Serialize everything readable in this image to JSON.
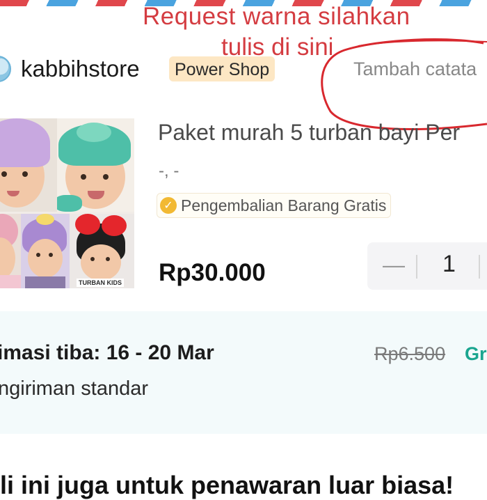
{
  "annotation": {
    "line1": "Request warna silahkan",
    "line2": "tulis di sini"
  },
  "store": {
    "name": "kabbihstore",
    "badge": "Power Shop",
    "note_link": "Tambah catata"
  },
  "product": {
    "title": "Paket murah 5 turban bayi Per",
    "variant": "-, -",
    "return_tag": "Pengembalian Barang Gratis",
    "price": "Rp30.000",
    "quantity": "1",
    "image_brand": "TURBAN KIDS"
  },
  "shipping": {
    "eta": "imasi tiba: 16 - 20 Mar",
    "fee_original": "Rp6.500",
    "fee_new": "Gr",
    "type": "ngiriman standar"
  },
  "bottom": {
    "text": "li ini juga untuk penawaran luar biasa!"
  },
  "colors": {
    "annotation": "#d43c41",
    "badge_bg": "#fde7c4",
    "free_green": "#1aa58f",
    "ship_bg": "#f3fafb"
  }
}
